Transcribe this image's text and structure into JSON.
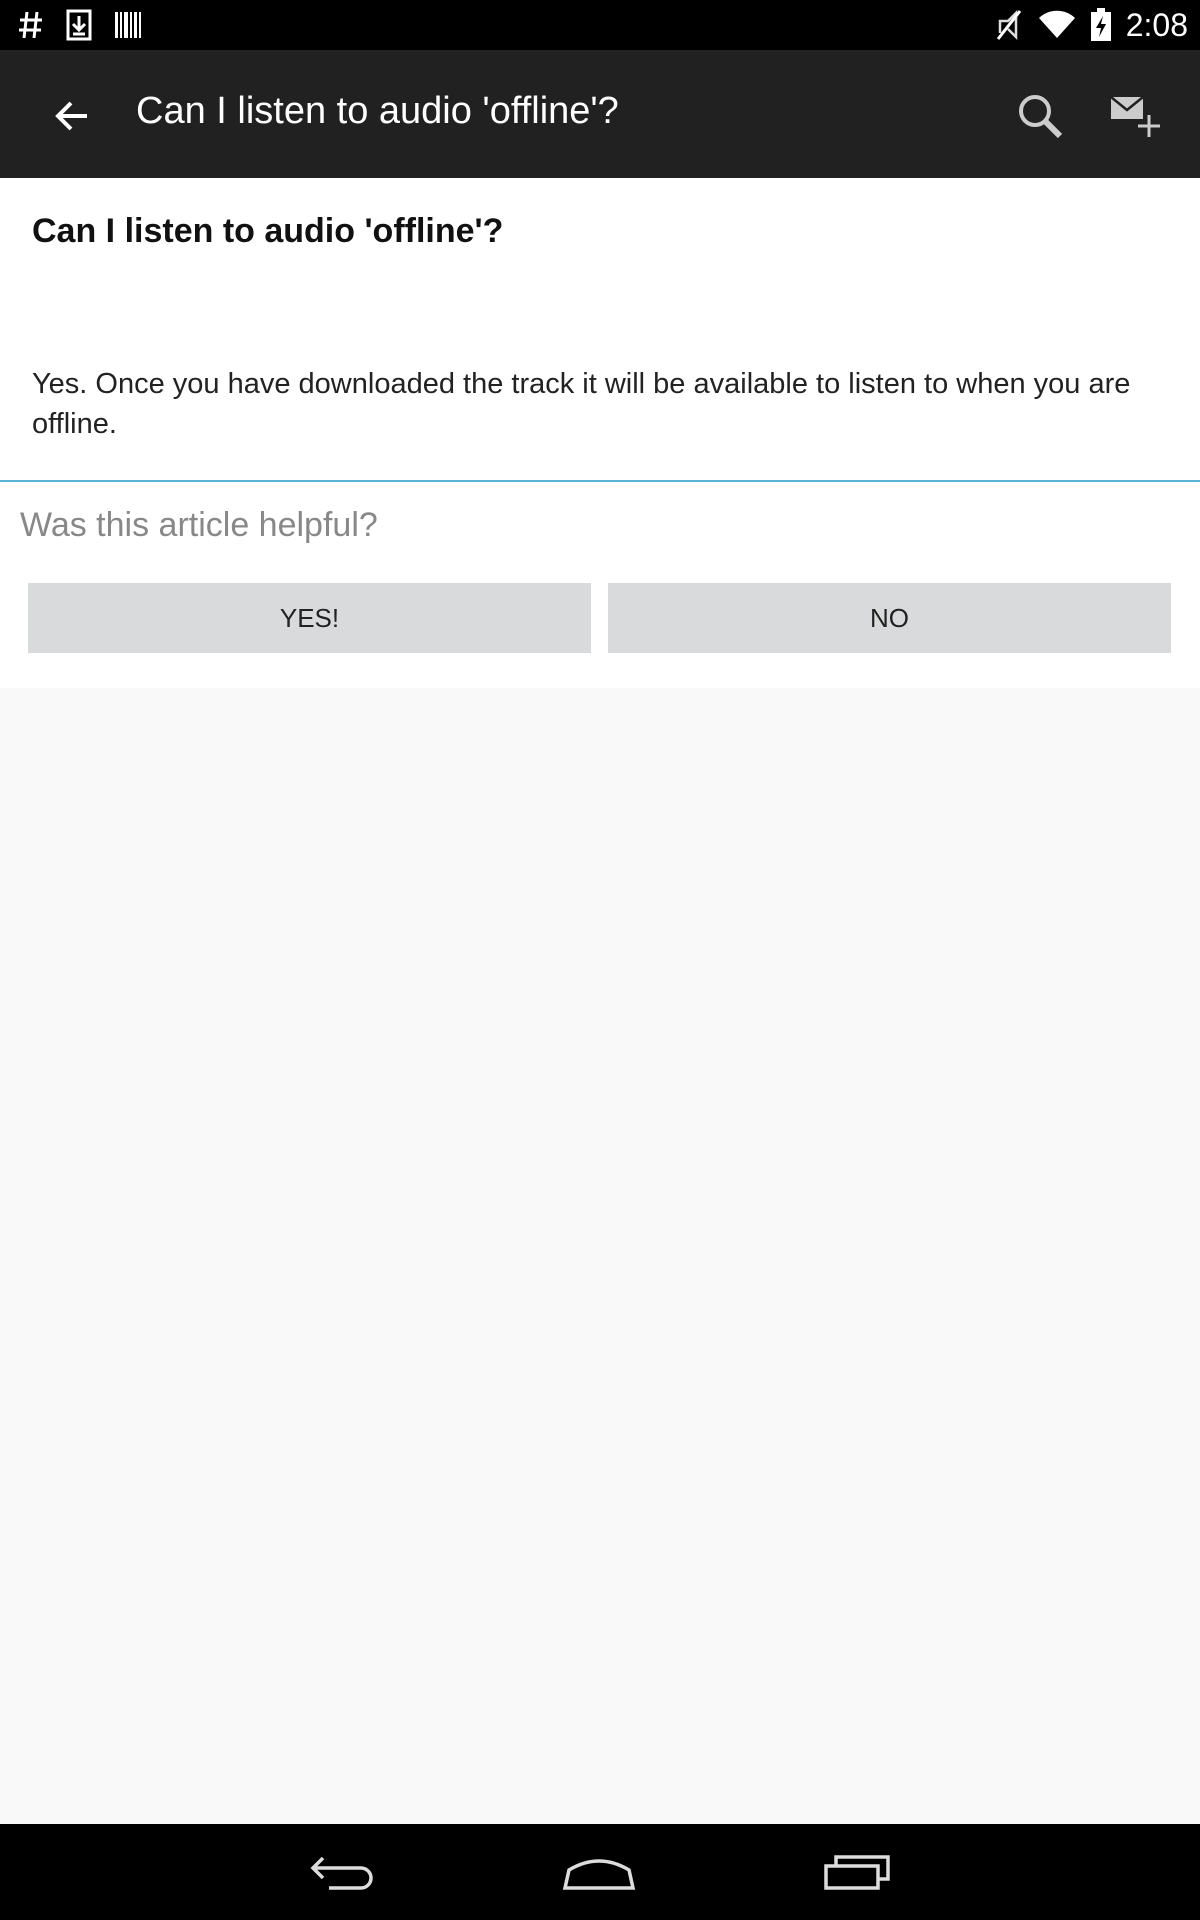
{
  "status_bar": {
    "time": "2:08",
    "left_icons": [
      "hash-icon",
      "download-icon",
      "barcode-icon"
    ],
    "right_icons": [
      "mute-icon",
      "wifi-icon",
      "battery-charging-icon"
    ]
  },
  "app_bar": {
    "title": "Can I listen to audio 'offline'?",
    "background": "#212121"
  },
  "article": {
    "title": "Can I listen to audio 'offline'?",
    "body": "Yes. Once you have downloaded the track it will be available to listen to when you are offline."
  },
  "feedback": {
    "question": "Was this article helpful?",
    "yes_label": "YES!",
    "no_label": "NO",
    "divider_color": "#5ab4d8"
  },
  "nav_bar": {
    "icons": [
      "back-nav-icon",
      "home-nav-icon",
      "recent-apps-icon"
    ]
  }
}
